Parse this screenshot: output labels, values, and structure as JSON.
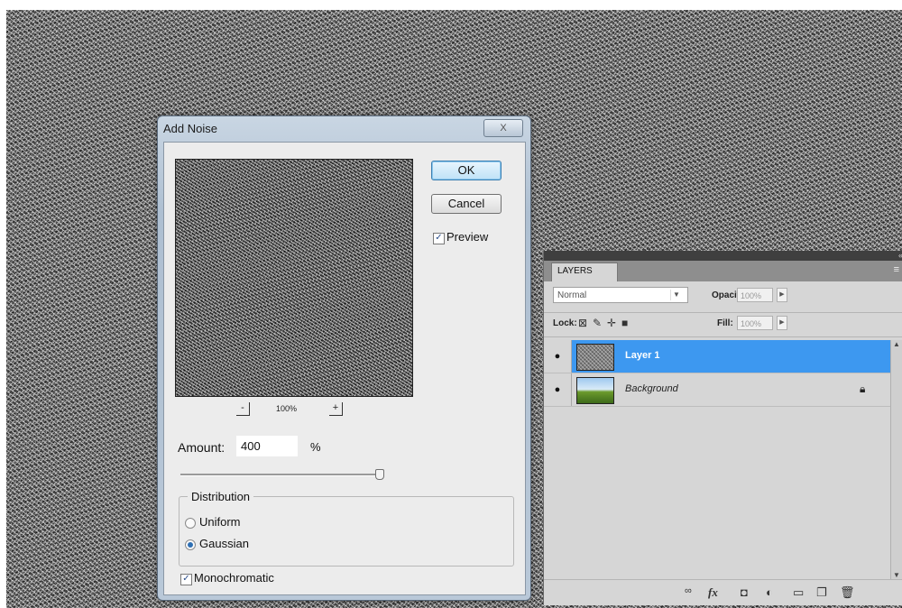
{
  "dialog": {
    "title": "Add Noise",
    "close_label": "X",
    "ok_label": "OK",
    "cancel_label": "Cancel",
    "preview_label": "Preview",
    "preview_checked": "✓",
    "zoom_minus": "-",
    "zoom_plus": "+",
    "zoom_level": "100%",
    "amount_label": "Amount:",
    "amount_value": "400",
    "amount_unit": "%",
    "amount_slider_fraction": 0.98,
    "distribution_legend": "Distribution",
    "uniform_label": "Uniform",
    "gaussian_label": "Gaussian",
    "selected_distribution": "Gaussian",
    "monochromatic_label": "Monochromatic",
    "monochromatic_checked": "✓"
  },
  "layers_panel": {
    "tab_label": "LAYERS",
    "blend_mode": "Normal",
    "opacity_label": "Opacity:",
    "opacity_value": "100%",
    "lock_label": "Lock:",
    "fill_label": "Fill:",
    "fill_value": "100%",
    "layers": [
      {
        "name": "Layer 1",
        "selected": true
      },
      {
        "name": "Background",
        "selected": false,
        "locked": true
      }
    ],
    "selected_color": "#3d98f0"
  }
}
